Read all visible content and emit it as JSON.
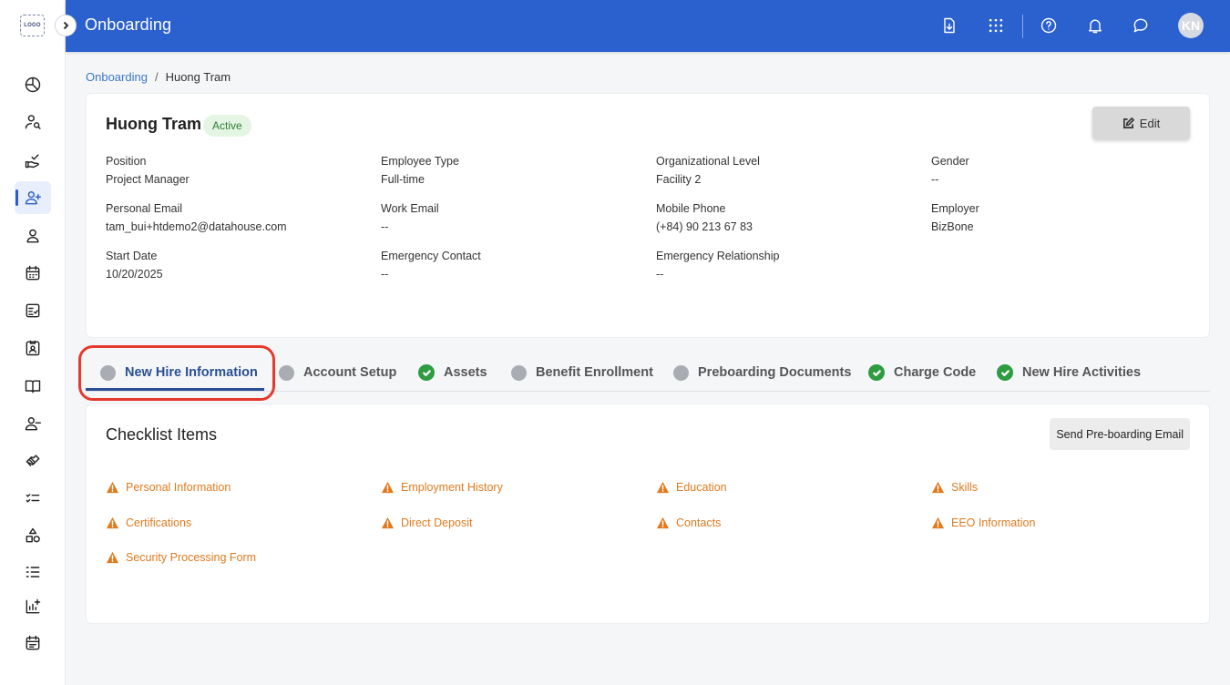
{
  "sidebar": {
    "logo_text": "LOGO",
    "items": [
      {
        "icon": "chart-pie-icon"
      },
      {
        "icon": "user-search-icon"
      },
      {
        "icon": "hand-check-icon"
      },
      {
        "icon": "user-add-icon",
        "active": true
      },
      {
        "icon": "user-icon"
      },
      {
        "icon": "calendar-grid-icon"
      },
      {
        "icon": "checklist-doc-icon"
      },
      {
        "icon": "id-badge-icon"
      },
      {
        "icon": "book-icon"
      },
      {
        "icon": "user-remove-icon"
      },
      {
        "icon": "handshake-icon"
      },
      {
        "icon": "task-list-icon"
      },
      {
        "icon": "shapes-icon"
      },
      {
        "icon": "ordered-list-icon"
      },
      {
        "icon": "chart-add-icon"
      },
      {
        "icon": "calendar-note-icon"
      }
    ]
  },
  "header": {
    "title": "Onboarding",
    "avatar_initials": "KN",
    "icons": [
      "download-doc-icon",
      "apps-grid-icon",
      "help-icon",
      "bell-icon",
      "chat-icon"
    ]
  },
  "breadcrumb": {
    "parent": "Onboarding",
    "separator": "/",
    "current": "Huong Tram"
  },
  "profile": {
    "name": "Huong Tram",
    "status": "Active",
    "edit_label": "Edit",
    "fields": {
      "position": {
        "label": "Position",
        "value": "Project Manager"
      },
      "employee_type": {
        "label": "Employee Type",
        "value": "Full-time"
      },
      "org_level": {
        "label": "Organizational Level",
        "value": "Facility 2"
      },
      "gender": {
        "label": "Gender",
        "value": "--"
      },
      "personal_email": {
        "label": "Personal Email",
        "value": "tam_bui+htdemo2@datahouse.com"
      },
      "work_email": {
        "label": "Work Email",
        "value": "--"
      },
      "mobile_phone": {
        "label": "Mobile Phone",
        "value": "(+84) 90 213 67 83"
      },
      "employer": {
        "label": "Employer",
        "value": "BizBone"
      },
      "start_date": {
        "label": "Start Date",
        "value": "10/20/2025"
      },
      "emergency_contact": {
        "label": "Emergency Contact",
        "value": "--"
      },
      "emergency_relationship": {
        "label": "Emergency Relationship",
        "value": "--"
      }
    }
  },
  "tabs": [
    {
      "label": "New Hire Information",
      "status": "pending",
      "active": true
    },
    {
      "label": "Account Setup",
      "status": "pending"
    },
    {
      "label": "Assets",
      "status": "complete"
    },
    {
      "label": "Benefit Enrollment",
      "status": "pending"
    },
    {
      "label": "Preboarding Documents",
      "status": "pending"
    },
    {
      "label": "Charge Code",
      "status": "complete"
    },
    {
      "label": "New Hire Activities",
      "status": "complete"
    }
  ],
  "checklist": {
    "title": "Checklist Items",
    "send_button": "Send Pre-boarding Email",
    "warning_color": "#e07a1f",
    "items": [
      "Personal Information",
      "Employment History",
      "Education",
      "Skills",
      "Certifications",
      "Direct Deposit",
      "Contacts",
      "EEO Information",
      "Security Processing Form"
    ]
  },
  "colors": {
    "header_bg": "#2b60cf",
    "active_tab": "#2a4f93",
    "complete_green": "#2e9c40",
    "highlight_ring": "#e5392d"
  }
}
